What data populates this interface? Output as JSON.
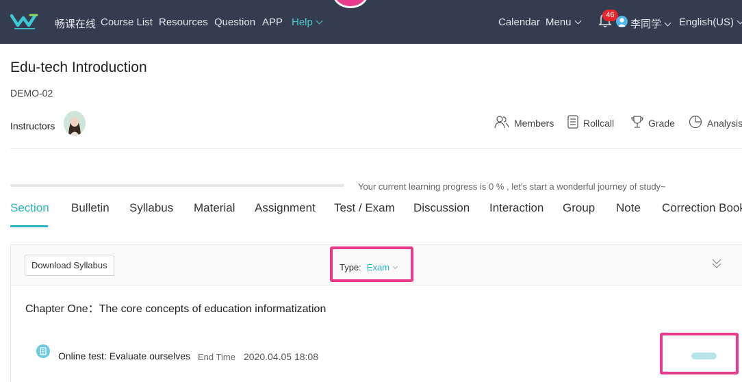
{
  "nav": {
    "brand": "畅课在线",
    "items": [
      {
        "label": "Course List"
      },
      {
        "label": "Resources"
      },
      {
        "label": "Question"
      },
      {
        "label": "APP"
      }
    ],
    "help": "Help",
    "right": {
      "calendar": "Calendar",
      "menu": "Menu",
      "notification_count": "46",
      "user": "李同学",
      "language": "English(US)"
    },
    "colors": {
      "bar": "#343c4f",
      "accent": "#4cc9cd",
      "badge": "#e7262e"
    }
  },
  "course": {
    "title": "Edu-tech Introduction",
    "code": "DEMO-02",
    "instructors_label": "Instructors",
    "tools": [
      {
        "label": "Members",
        "icon": "members-icon"
      },
      {
        "label": "Rollcall",
        "icon": "rollcall-icon"
      },
      {
        "label": "Grade",
        "icon": "trophy-icon"
      },
      {
        "label": "Analysis",
        "icon": "pie-chart-icon"
      }
    ]
  },
  "progress": {
    "percent": 0,
    "text": "Your current learning progress is 0 % , let's start a wonderful journey of study~"
  },
  "tabs": [
    {
      "label": "Section",
      "active": true
    },
    {
      "label": "Bulletin"
    },
    {
      "label": "Syllabus"
    },
    {
      "label": "Material"
    },
    {
      "label": "Assignment"
    },
    {
      "label": "Test / Exam"
    },
    {
      "label": "Discussion"
    },
    {
      "label": "Interaction"
    },
    {
      "label": "Group"
    },
    {
      "label": "Note"
    },
    {
      "label": "Correction Book"
    }
  ],
  "section": {
    "download_label": "Download Syllabus",
    "type_label": "Type:",
    "type_value": "Exam",
    "chapter_title": "Chapter One：The core concepts of education informatization",
    "activity": {
      "title": "Online test: Evaluate ourselves",
      "end_time_label": "End Time",
      "end_time_value": "2020.04.05 18:08"
    }
  },
  "colors": {
    "accent": "#29b4c6",
    "highlight": "#ea3a8c"
  }
}
